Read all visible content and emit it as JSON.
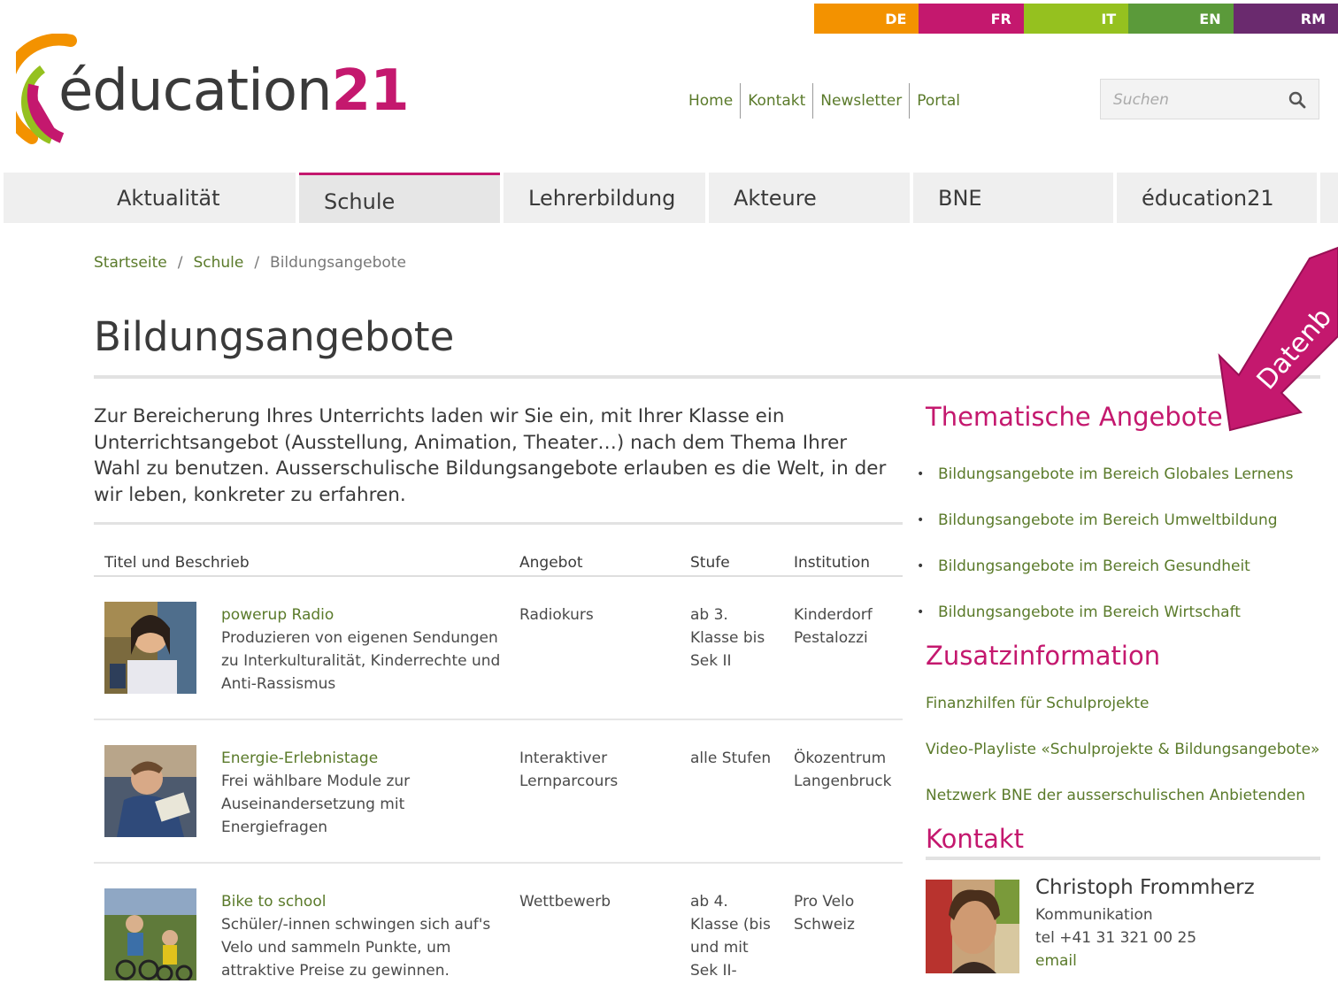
{
  "languages": [
    {
      "code": "DE",
      "color": "#f39200"
    },
    {
      "code": "FR",
      "color": "#c4186e"
    },
    {
      "code": "IT",
      "color": "#95c11f"
    },
    {
      "code": "EN",
      "color": "#5b9a3a"
    },
    {
      "code": "RM",
      "color": "#6a2a6e"
    }
  ],
  "logo": {
    "text": "éducation",
    "number": "21",
    "brand_color": "#c4186e"
  },
  "toplinks": [
    "Home",
    "Kontakt",
    "Newsletter",
    "Portal"
  ],
  "search": {
    "placeholder": "Suchen",
    "icon": "search-icon"
  },
  "nav": [
    "Aktualität",
    "Schule",
    "Lehrerbildung",
    "Akteure",
    "BNE",
    "éducation21"
  ],
  "nav_active": "Schule",
  "breadcrumb": {
    "home": "Startseite",
    "section": "Schule",
    "current": "Bildungsangebote"
  },
  "page": {
    "title": "Bildungsangebote",
    "intro": "Zur Bereicherung Ihres Unterrichts laden wir Sie ein, mit Ihrer Klasse ein Unterrichtsangebot (Ausstellung, Animation, Theater…) nach dem Thema Ihrer Wahl zu benutzen. Ausserschulische Bildungsangebote erlauben es die Welt, in der wir leben, konkreter zu erfahren."
  },
  "table": {
    "headers": [
      "Titel und Beschrieb",
      "Angebot",
      "Stufe",
      "Institution"
    ],
    "rows": [
      {
        "title": "powerup Radio",
        "desc": "Produzieren von eigenen Sendungen zu Interkulturalität, Kinderrechte und Anti-Rassismus",
        "angebot": "Radiokurs",
        "stufe": "ab 3. Klasse bis Sek II",
        "institution": "Kinderdorf Pestalozzi"
      },
      {
        "title": "Energie-Erlebnistage",
        "desc": "Frei wählbare Module zur Auseinandersetzung mit Energiefragen",
        "angebot": "Interaktiver Lernparcours",
        "stufe": "alle Stufen",
        "institution": "Ökozentrum Langenbruck"
      },
      {
        "title": "Bike to school",
        "desc": "Schüler/-innen schwingen sich auf's Velo und sammeln Punkte, um attraktive Preise zu gewinnen.",
        "angebot": "Wettbewerb",
        "stufe": "ab 4. Klasse (bis und mit Sek II-",
        "institution": "Pro Velo Schweiz"
      }
    ]
  },
  "sidebar": {
    "thematic_heading": "Thematische Angebote",
    "thematic_links": [
      "Bildungsangebote im Bereich Globales Lernens",
      "Bildungsangebote im Bereich Umweltbildung",
      "Bildungsangebote im Bereich Gesundheit",
      "Bildungsangebote im Bereich Wirtschaft"
    ],
    "extra_heading": "Zusatzinformation",
    "extra_links": [
      "Finanzhilfen für Schulprojekte",
      "Video-Playliste «Schulprojekte & Bildungsangebote»",
      "Netzwerk BNE der ausserschulischen Anbietenden"
    ],
    "contact_heading": "Kontakt",
    "contact": {
      "name": "Christoph Frommherz",
      "role": "Kommunikation",
      "tel": "tel +41 31 321 00 25",
      "email": "email"
    }
  },
  "annotation": {
    "text": "Datenb",
    "color": "#c4186e"
  }
}
